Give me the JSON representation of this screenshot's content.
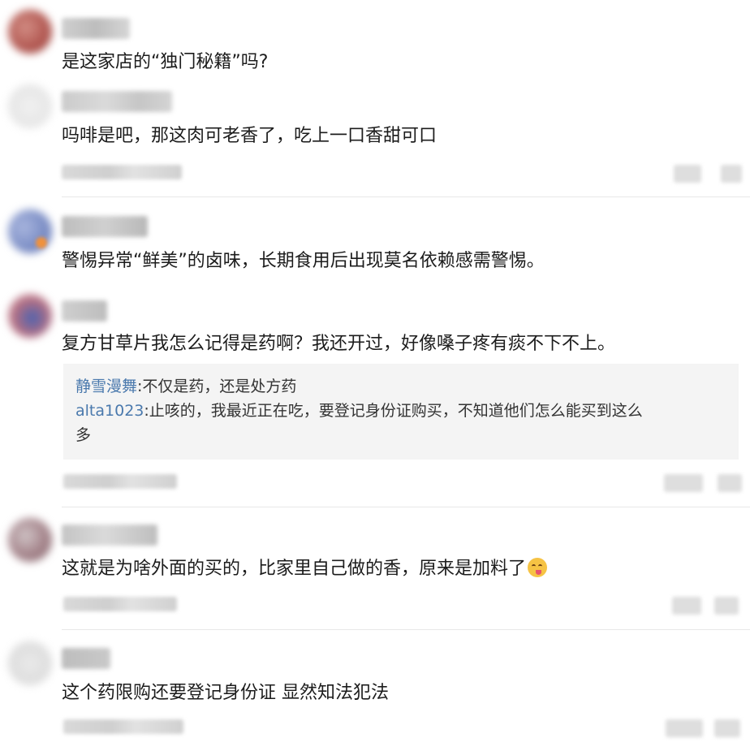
{
  "comments": [
    {
      "text": "是这家店的“独门秘籍”吗?",
      "avatar_color": "#b0554f",
      "avatar_accent": "#d38e85"
    },
    {
      "text": "吗啡是吧，那这肉可老香了，吃上一口香甜可口",
      "avatar_color": "#e6e6e6",
      "avatar_accent": "#f1f1f1"
    },
    {
      "text": "警惕异常“鲜美”的卤味，长期食用后出现莫名依赖感需警惕。",
      "avatar_color": "#7d8fc6",
      "avatar_accent": "#f0913c"
    },
    {
      "text": "复方甘草片我怎么记得是药啊？我还开过，好像嗓子疼有痰不下不上。",
      "avatar_color": "#b87081",
      "avatar_accent": "#4b62b0",
      "replies": [
        {
          "name": "静雪漫舞",
          "text": ":不仅是药，还是处方药"
        },
        {
          "name": "alta1023",
          "text": ":止咳的，我最近正在吃，要登记身份证购买，不知道他们怎么能买到这么",
          "text2": "多"
        }
      ]
    },
    {
      "text": "这就是为啥外面的买的，比家里自己做的香，原来是加料了",
      "emoji": "yum-emoji-icon",
      "avatar_color": "#a4838a",
      "avatar_accent": "#d0c4c6"
    },
    {
      "text": "这个药限购还要登记身份证 显然知法犯法",
      "avatar_color": "#dcdcdc",
      "avatar_accent": "#eaeaea"
    }
  ],
  "colors": {
    "text": "#1c1c1c",
    "reply_name": "#4a79ad",
    "reply_bg": "#f4f4f4",
    "divider": "#e8e8e8"
  }
}
